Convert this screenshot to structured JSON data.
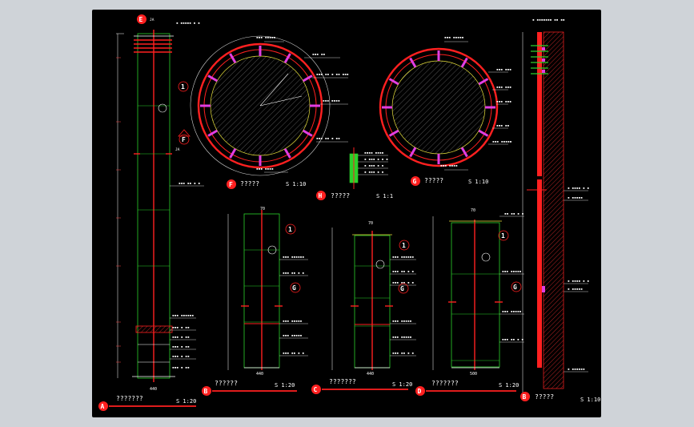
{
  "drawing": {
    "views": [
      {
        "letter": "A",
        "title": "???????",
        "scale": "S 1:20"
      },
      {
        "letter": "B",
        "title": "??????",
        "scale": "S 1:20"
      },
      {
        "letter": "C",
        "title": "???????",
        "scale": "S 1:20"
      },
      {
        "letter": "D",
        "title": "???????",
        "scale": "S 1:20"
      },
      {
        "letter": "B",
        "title": "?????",
        "scale": "S 1:10"
      },
      {
        "letter": "F",
        "title": "?????",
        "scale": "S 1:10"
      },
      {
        "letter": "G",
        "title": "?????",
        "scale": "S 1:10"
      },
      {
        "letter": "H",
        "title": "?????",
        "scale": "S 1:1"
      }
    ],
    "markers": {
      "e": "E",
      "ja": "JA",
      "f": "F",
      "g": "G",
      "one": "1",
      "a": "A"
    },
    "dims": {
      "a_width": "440",
      "b_width": "440",
      "c_width": "440",
      "d_width": "500",
      "c_top": "70",
      "b_top": "70",
      "d_top": "70"
    }
  }
}
